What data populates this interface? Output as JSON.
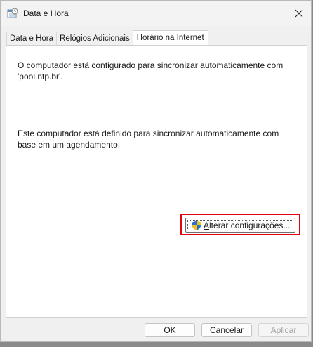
{
  "window": {
    "title": "Data e Hora",
    "icon": "clock-calendar-icon"
  },
  "tabs": [
    {
      "label": "Data e Hora",
      "active": false
    },
    {
      "label": "Relógios Adicionais",
      "active": false
    },
    {
      "label": "Horário na Internet",
      "active": true
    }
  ],
  "panel": {
    "sync_text": "O computador está configurado para sincronizar automaticamente com 'pool.ntp.br'.",
    "schedule_text": "Este computador está definido para sincronizar automaticamente com base em um agendamento.",
    "change_settings_prefix": "A",
    "change_settings_rest": "lterar configurações..."
  },
  "footer": {
    "ok_label": "OK",
    "cancel_label": "Cancelar",
    "apply_prefix": "A",
    "apply_rest": "plicar"
  },
  "colors": {
    "highlight": "#e3000f"
  }
}
